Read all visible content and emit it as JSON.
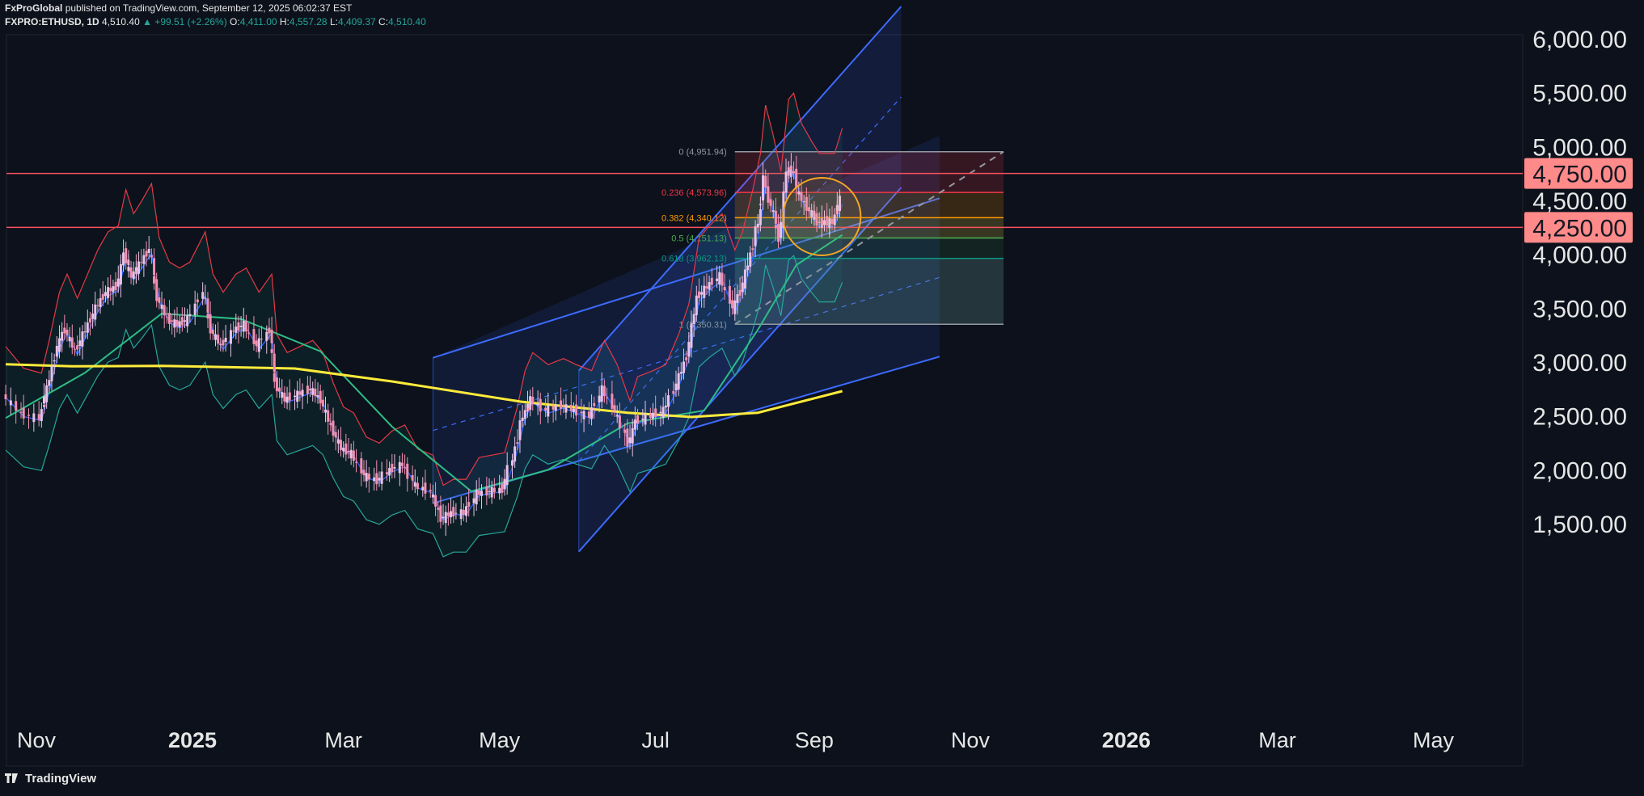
{
  "header": {
    "publisher": "FxProGlobal",
    "published_text": "published on TradingView.com, September 12, 2025 06:02:37 EST",
    "symbol": "FXPRO:ETHUSD, 1D",
    "last": "4,510.40",
    "change": "▲ +99.51 (+2.26%)",
    "open_label": "O:",
    "open": "4,411.00",
    "high_label": "H:",
    "high": "4,557.28",
    "low_label": "L:",
    "low": "4,409.37",
    "close_label": "C:",
    "close": "4,510.40"
  },
  "footer": {
    "brand": "TradingView"
  },
  "colors": {
    "background": "#0c111b",
    "candle_up": "#e8c2e8",
    "candle_down": "#f48fb1",
    "ma_200": "#ffeb3b",
    "ma_50": "#2ebd85",
    "bb_upper": "#e53945",
    "bb_lower": "#26a69a",
    "bb_mid": "#2962ff",
    "channel": "#3d6bff",
    "resistance": "#f7525f",
    "highlight_circle": "#f5a623"
  },
  "chart_data": {
    "type": "line",
    "symbol": "FXPRO:ETHUSD",
    "interval": "1D",
    "y_axis": {
      "ticks": [
        "6,000.00",
        "5,500.00",
        "5,000.00",
        "4,500.00",
        "4,000.00",
        "3,500.00",
        "3,000.00",
        "2,500.00",
        "2,000.00",
        "1,500.00"
      ],
      "tick_values": [
        6000,
        5500,
        5000,
        4500,
        4000,
        3500,
        3000,
        2500,
        2000,
        1500
      ],
      "range": [
        1200,
        6300
      ]
    },
    "x_axis": {
      "ticks": [
        "Nov",
        "2025",
        "Mar",
        "May",
        "Jul",
        "Sep",
        "Nov",
        "2026",
        "Mar",
        "May"
      ],
      "tick_dates": [
        "2024-11-01",
        "2025-01-01",
        "2025-03-01",
        "2025-05-01",
        "2025-07-01",
        "2025-09-01",
        "2025-11-01",
        "2026-01-01",
        "2026-03-01",
        "2026-05-01"
      ]
    },
    "price_labels": [
      {
        "text": "4,750.00",
        "value": 4750
      },
      {
        "text": "4,250.00",
        "value": 4250
      }
    ],
    "horizontal_levels": [
      4750,
      4250
    ],
    "fibonacci": {
      "levels": [
        {
          "label": "0 (4,951.94)",
          "value": 4951.94,
          "color": "#9598a1"
        },
        {
          "label": "0.236 (4,573.96)",
          "value": 4573.96,
          "color": "#f23645"
        },
        {
          "label": "0.382 (4,340.12)",
          "value": 4340.12,
          "color": "#ff9800"
        },
        {
          "label": "0.5 (4,151.13)",
          "value": 4151.13,
          "color": "#4caf50"
        },
        {
          "label": "0.618 (3,962.13)",
          "value": 3962.13,
          "color": "#089981"
        },
        {
          "label": "1 (3,350.31)",
          "value": 3350.31,
          "color": "#9598a1"
        }
      ],
      "start_date": "2025-08-01",
      "end_date": "2025-11-14"
    },
    "close_series": [
      [
        "2024-10-20",
        2700
      ],
      [
        "2024-10-27",
        2520
      ],
      [
        "2024-11-03",
        2480
      ],
      [
        "2024-11-06",
        2750
      ],
      [
        "2024-11-10",
        3150
      ],
      [
        "2024-11-13",
        3300
      ],
      [
        "2024-11-17",
        3100
      ],
      [
        "2024-11-21",
        3300
      ],
      [
        "2024-11-25",
        3500
      ],
      [
        "2024-11-29",
        3650
      ],
      [
        "2024-12-03",
        3700
      ],
      [
        "2024-12-06",
        4000
      ],
      [
        "2024-12-09",
        3800
      ],
      [
        "2024-12-12",
        3900
      ],
      [
        "2024-12-16",
        4050
      ],
      [
        "2024-12-19",
        3600
      ],
      [
        "2024-12-23",
        3400
      ],
      [
        "2024-12-27",
        3350
      ],
      [
        "2024-12-31",
        3400
      ],
      [
        "2025-01-06",
        3650
      ],
      [
        "2025-01-09",
        3300
      ],
      [
        "2025-01-13",
        3150
      ],
      [
        "2025-01-18",
        3300
      ],
      [
        "2025-01-22",
        3350
      ],
      [
        "2025-01-27",
        3150
      ],
      [
        "2025-02-01",
        3300
      ],
      [
        "2025-02-03",
        2800
      ],
      [
        "2025-02-07",
        2650
      ],
      [
        "2025-02-12",
        2700
      ],
      [
        "2025-02-17",
        2750
      ],
      [
        "2025-02-21",
        2650
      ],
      [
        "2025-02-25",
        2400
      ],
      [
        "2025-03-01",
        2200
      ],
      [
        "2025-03-05",
        2150
      ],
      [
        "2025-03-10",
        1950
      ],
      [
        "2025-03-15",
        1900
      ],
      [
        "2025-03-20",
        2000
      ],
      [
        "2025-03-25",
        2050
      ],
      [
        "2025-03-30",
        1850
      ],
      [
        "2025-04-05",
        1800
      ],
      [
        "2025-04-09",
        1550
      ],
      [
        "2025-04-13",
        1600
      ],
      [
        "2025-04-18",
        1600
      ],
      [
        "2025-04-23",
        1780
      ],
      [
        "2025-04-28",
        1800
      ],
      [
        "2025-05-03",
        1820
      ],
      [
        "2025-05-08",
        2200
      ],
      [
        "2025-05-11",
        2500
      ],
      [
        "2025-05-14",
        2650
      ],
      [
        "2025-05-20",
        2550
      ],
      [
        "2025-05-26",
        2600
      ],
      [
        "2025-05-31",
        2550
      ],
      [
        "2025-06-06",
        2500
      ],
      [
        "2025-06-11",
        2750
      ],
      [
        "2025-06-16",
        2550
      ],
      [
        "2025-06-21",
        2250
      ],
      [
        "2025-06-24",
        2450
      ],
      [
        "2025-06-30",
        2500
      ],
      [
        "2025-07-05",
        2550
      ],
      [
        "2025-07-10",
        2800
      ],
      [
        "2025-07-14",
        3050
      ],
      [
        "2025-07-18",
        3600
      ],
      [
        "2025-07-22",
        3700
      ],
      [
        "2025-07-27",
        3800
      ],
      [
        "2025-08-01",
        3500
      ],
      [
        "2025-08-04",
        3650
      ],
      [
        "2025-08-08",
        4000
      ],
      [
        "2025-08-11",
        4300
      ],
      [
        "2025-08-13",
        4700
      ],
      [
        "2025-08-16",
        4450
      ],
      [
        "2025-08-19",
        4150
      ],
      [
        "2025-08-22",
        4750
      ],
      [
        "2025-08-24",
        4800
      ],
      [
        "2025-08-27",
        4550
      ],
      [
        "2025-08-31",
        4400
      ],
      [
        "2025-09-03",
        4300
      ],
      [
        "2025-09-06",
        4300
      ],
      [
        "2025-09-09",
        4300
      ],
      [
        "2025-09-12",
        4510
      ]
    ],
    "indicators": {
      "ma_200": [
        [
          "2024-10-20",
          2980
        ],
        [
          "2024-11-15",
          2960
        ],
        [
          "2024-12-20",
          2965
        ],
        [
          "2025-02-10",
          2940
        ],
        [
          "2025-03-20",
          2820
        ],
        [
          "2025-05-10",
          2630
        ],
        [
          "2025-06-20",
          2530
        ],
        [
          "2025-07-15",
          2490
        ],
        [
          "2025-08-10",
          2530
        ],
        [
          "2025-09-12",
          2730
        ]
      ],
      "ma_50": [
        [
          "2024-10-20",
          2480
        ],
        [
          "2024-11-20",
          2900
        ],
        [
          "2024-12-20",
          3450
        ],
        [
          "2025-01-20",
          3400
        ],
        [
          "2025-02-20",
          3100
        ],
        [
          "2025-03-20",
          2400
        ],
        [
          "2025-04-20",
          1800
        ],
        [
          "2025-05-20",
          2000
        ],
        [
          "2025-06-20",
          2430
        ],
        [
          "2025-07-20",
          2550
        ],
        [
          "2025-08-10",
          3300
        ],
        [
          "2025-08-25",
          3900
        ],
        [
          "2025-09-12",
          4180
        ]
      ]
    },
    "annotations": [
      "ascending channel",
      "fibonacci retracement",
      "orange circle around consolidation near 4,250–4,500"
    ],
    "grid": false
  }
}
